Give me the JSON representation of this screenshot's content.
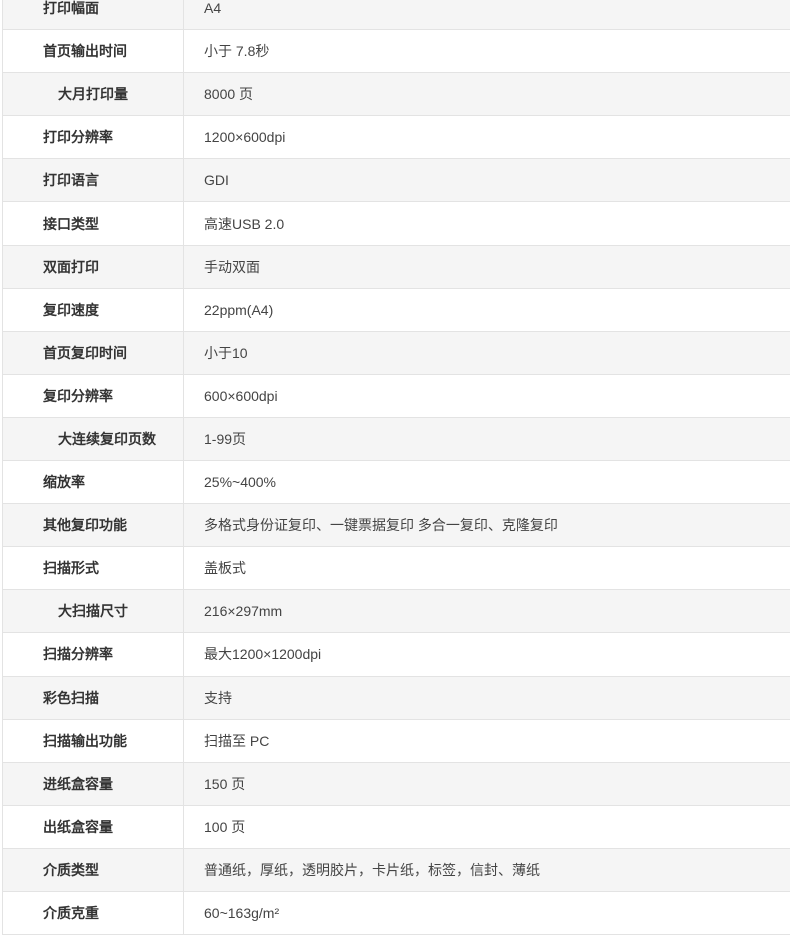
{
  "specs": [
    {
      "label": "打印幅面",
      "value": "A4"
    },
    {
      "label": "首页输出时间",
      "value": "小于 7.8秒"
    },
    {
      "label": "大月打印量",
      "value": "8000 页",
      "indent": true
    },
    {
      "label": "打印分辨率",
      "value": "1200×600dpi"
    },
    {
      "label": "打印语言",
      "value": "GDI"
    },
    {
      "label": "接口类型",
      "value": "高速USB 2.0"
    },
    {
      "label": "双面打印",
      "value": "手动双面"
    },
    {
      "label": "复印速度",
      "value": "22ppm(A4)"
    },
    {
      "label": "首页复印时间",
      "value": "小于10"
    },
    {
      "label": "复印分辨率",
      "value": "600×600dpi"
    },
    {
      "label": "大连续复印页数",
      "value": "1-99页",
      "indent": true
    },
    {
      "label": "缩放率",
      "value": "25%~400%"
    },
    {
      "label": "其他复印功能",
      "value": "多格式身份证复印、一键票据复印 多合一复印、克隆复印"
    },
    {
      "label": "扫描形式",
      "value": "盖板式"
    },
    {
      "label": "大扫描尺寸",
      "value": "216×297mm",
      "indent": true
    },
    {
      "label": "扫描分辨率",
      "value": "最大1200×1200dpi"
    },
    {
      "label": "彩色扫描",
      "value": "支持"
    },
    {
      "label": "扫描输出功能",
      "value": "扫描至 PC"
    },
    {
      "label": "进纸盒容量",
      "value": "150 页"
    },
    {
      "label": "出纸盒容量",
      "value": "100 页"
    },
    {
      "label": "介质类型",
      "value": "普通纸，厚纸，透明胶片，卡片纸，标签，信封、薄纸"
    },
    {
      "label": "介质克重",
      "value": "60~163g/m²"
    }
  ]
}
